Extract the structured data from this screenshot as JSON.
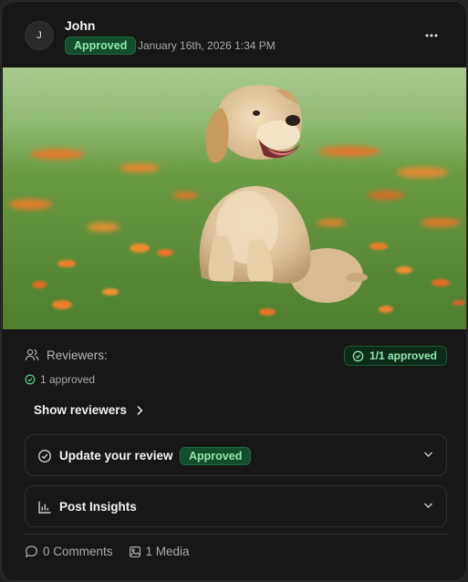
{
  "post": {
    "author_initial": "J",
    "author_name": "John",
    "status": "Approved",
    "date": "January 16th, 2026 1:34 PM"
  },
  "image": {
    "subject": "golden retriever puppy sitting in grass with orange flowers",
    "colors": {
      "grass": "#6a9a42",
      "flowers": "#e8762a",
      "fur": "#dcc29a"
    }
  },
  "reviewers": {
    "label": "Reviewers:",
    "summary_badge": "1/1 approved",
    "approved_count": "1 approved",
    "show_label": "Show reviewers"
  },
  "sections": [
    {
      "title": "Update your review",
      "badge": "Approved",
      "icon": "check-circle-icon"
    },
    {
      "title": "Post Insights",
      "icon": "bar-chart-icon"
    }
  ],
  "footer": {
    "comments": "0 Comments",
    "media": "1 Media"
  },
  "colors": {
    "card_bg": "#171717",
    "accent_green": "#8ee8ae",
    "badge_bg": "#134d2c"
  }
}
